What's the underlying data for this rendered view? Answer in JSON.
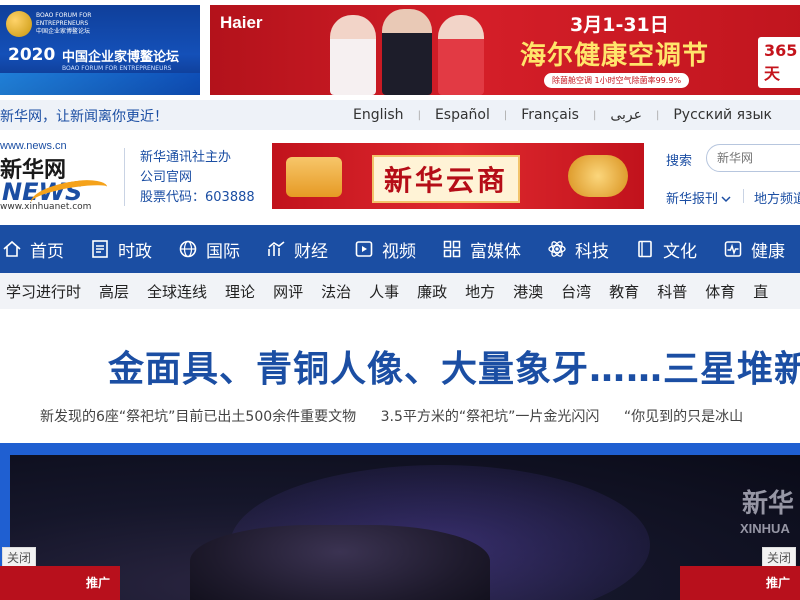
{
  "ads": {
    "left": {
      "line1": "BOAO FORUM FOR",
      "line2": "ENTREPRENEURS",
      "line3": "中国企业家博鳌论坛",
      "year": "2020",
      "title": "中国企业家博鳌论坛",
      "subtitle": "BOAO FORUM FOR ENTREPRENEURS"
    },
    "right": {
      "brand": "Haier",
      "date": "3月1-31日",
      "slogan": "海尔健康空调节",
      "pill": "除菌舱空调 1小时空气除菌率99.9%",
      "side": "365天"
    },
    "cloud": {
      "title": "新华云商"
    }
  },
  "langbar": {
    "slogan": "新华网，让新闻离你更近！",
    "languages": [
      "English",
      "Español",
      "Français",
      "عربى",
      "Русский язык"
    ]
  },
  "logo": {
    "url": "www.news.cn",
    "cn": "新华网",
    "en_letters": "NEWS",
    "en_url": "www.xinhuanet.com"
  },
  "corp": {
    "line1": "新华通讯社主办",
    "line2": "公司官网",
    "line3": "股票代码：603888"
  },
  "search": {
    "label": "搜索",
    "placeholder": "新华网"
  },
  "sublinks": {
    "paper": "新华报刊",
    "local": "地方频道"
  },
  "mainnav": [
    {
      "label": "首页",
      "icon": "home-icon"
    },
    {
      "label": "时政",
      "icon": "document-icon"
    },
    {
      "label": "国际",
      "icon": "globe-icon"
    },
    {
      "label": "财经",
      "icon": "chart-icon"
    },
    {
      "label": "视频",
      "icon": "play-icon"
    },
    {
      "label": "富媒体",
      "icon": "grid-icon"
    },
    {
      "label": "科技",
      "icon": "atom-icon"
    },
    {
      "label": "文化",
      "icon": "book-icon"
    },
    {
      "label": "健康",
      "icon": "pulse-icon"
    }
  ],
  "subnav": [
    "学习进行时",
    "高层",
    "全球连线",
    "理论",
    "网评",
    "法治",
    "人事",
    "廉政",
    "地方",
    "港澳",
    "台湾",
    "教育",
    "科普",
    "体育",
    "直"
  ],
  "headline": {
    "title": "金面具、青铜人像、大量象牙……三星堆新",
    "subs": [
      "新发现的6座“祭祀坑”目前已出土500余件重要文物",
      "3.5平方米的“祭祀坑”一片金光闪闪",
      "“你见到的只是冰山"
    ]
  },
  "hero": {
    "watermark": "新华",
    "watermark_en": "XINHUA"
  },
  "floating": {
    "close_label": "关闭",
    "promo_label": "推广"
  },
  "colors": {
    "brand_blue": "#1b4ea3",
    "nav_blue": "#1b4ea3",
    "promo_red": "#b8101c"
  }
}
